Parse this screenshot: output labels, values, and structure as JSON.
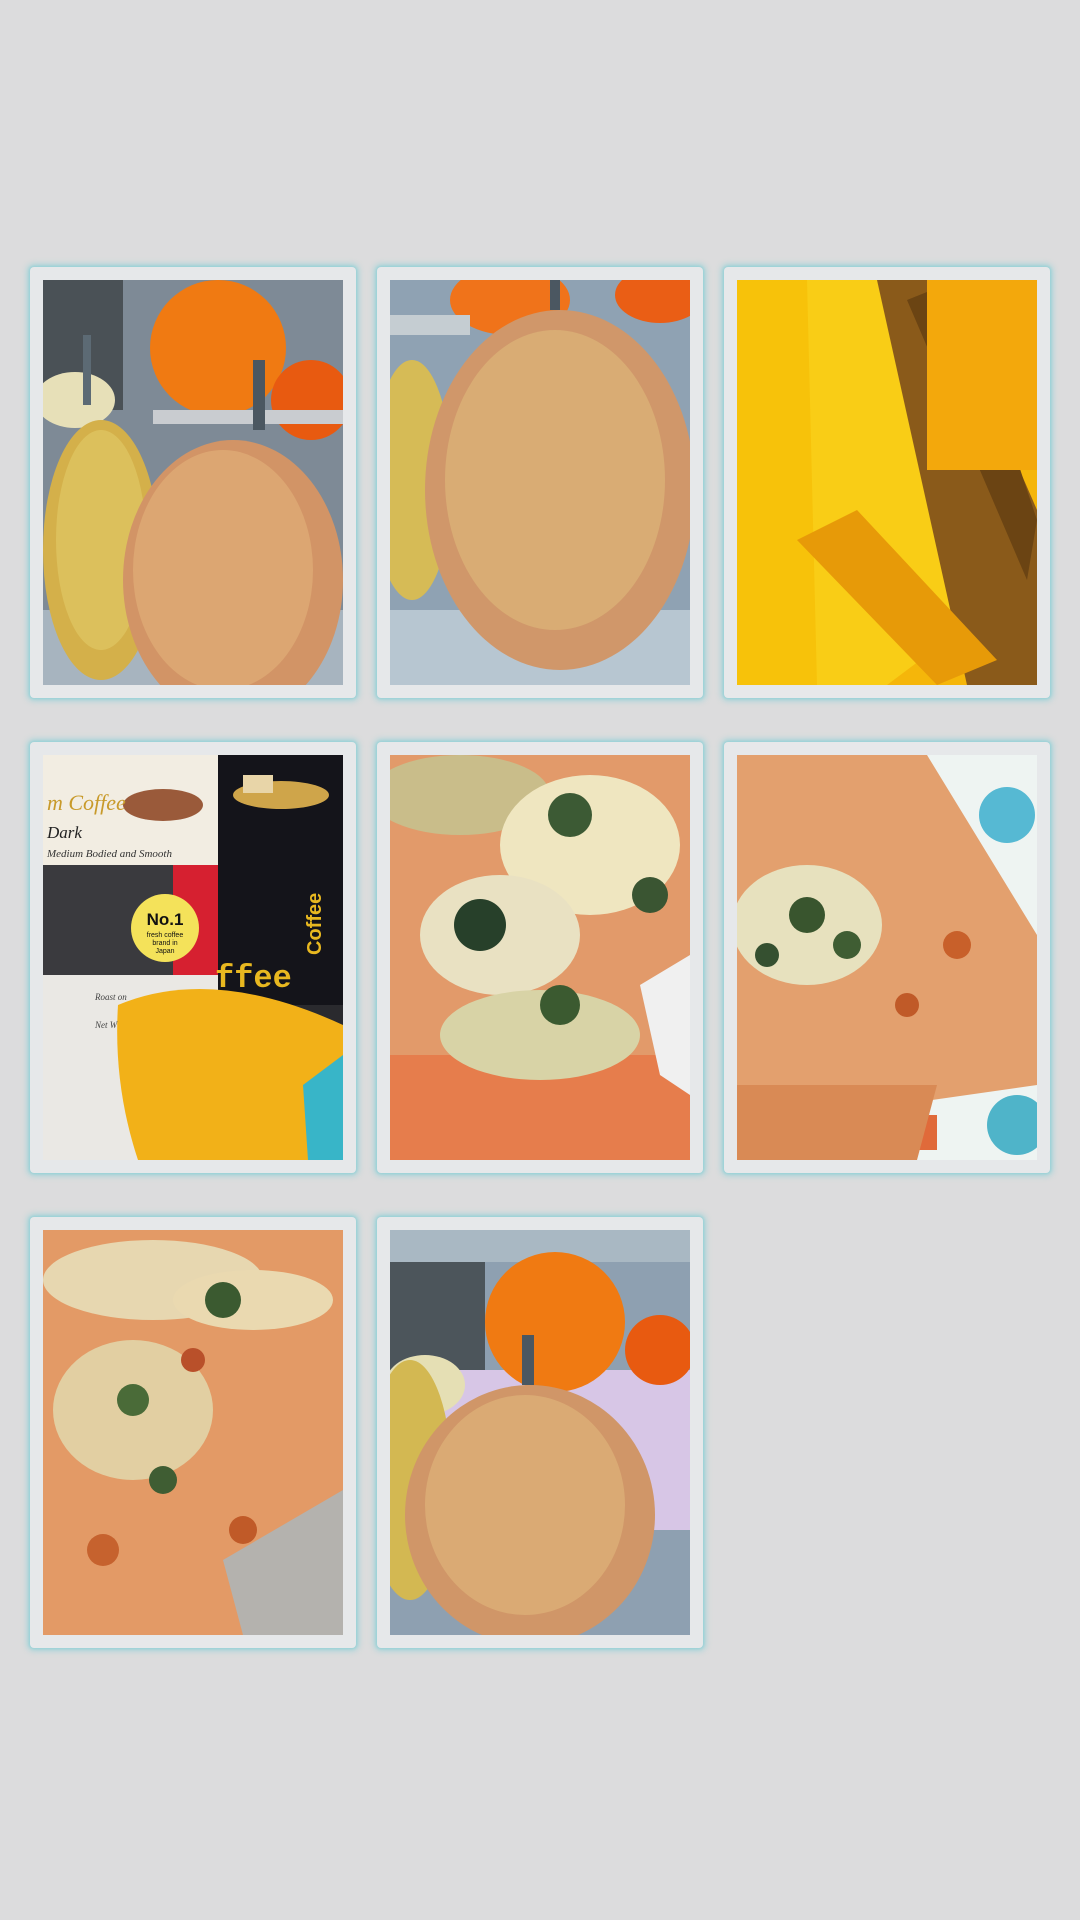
{
  "gallery": {
    "tiles": [
      {
        "subject": "two pears with orange on fridge shelf"
      },
      {
        "subject": "close-up pear"
      },
      {
        "subject": "sliced mango"
      },
      {
        "subject": "coffee package with mango slice"
      },
      {
        "subject": "pizza slice with spinach and cheese"
      },
      {
        "subject": "pizza slice on printed plate"
      },
      {
        "subject": "pizza slices on tray"
      },
      {
        "subject": "pear with orange in fridge"
      }
    ],
    "coffee_package": {
      "brand_partial": "m Coffee",
      "roast": "Dark",
      "tagline": "Medium Bodied and Smooth",
      "badge_title": "No.1",
      "badge_line1": "fresh coffee",
      "badge_line2": "brand in",
      "badge_line3": "Japan",
      "can_text": "ffee",
      "can_side": "Coffee",
      "roast_label": "Roast on",
      "weight_label": "Net W"
    }
  }
}
